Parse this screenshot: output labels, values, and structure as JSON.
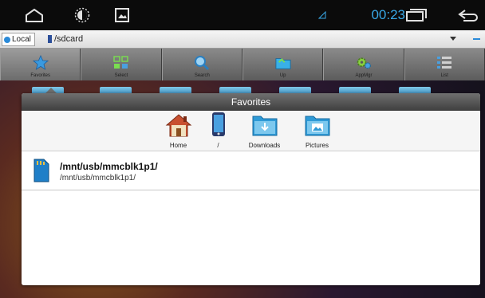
{
  "statusbar": {
    "clock": "00:23",
    "icons": [
      "home-outline-icon",
      "brightness-icon",
      "gallery-icon",
      "signal-icon",
      "recent-apps-icon",
      "back-icon"
    ],
    "clock_color": "#39a9e8"
  },
  "pathbar": {
    "local_label": "Local",
    "path": "/sdcard"
  },
  "toolbar": {
    "buttons": [
      {
        "label": "Favorites",
        "icon": "star-icon"
      },
      {
        "label": "Select",
        "icon": "select-grid-icon"
      },
      {
        "label": "Search",
        "icon": "magnifier-icon"
      },
      {
        "label": "Up",
        "icon": "folder-up-icon"
      },
      {
        "label": "AppMgr",
        "icon": "gears-icon"
      },
      {
        "label": "List",
        "icon": "list-icon"
      }
    ]
  },
  "dialog": {
    "title": "Favorites",
    "bookmarks": [
      {
        "label": "Home",
        "icon": "house-icon"
      },
      {
        "label": "/",
        "icon": "phone-icon"
      },
      {
        "label": "Downloads",
        "icon": "downloads-folder-icon"
      },
      {
        "label": "Pictures",
        "icon": "pictures-folder-icon"
      }
    ],
    "items": [
      {
        "title": "/mnt/usb/mmcblk1p1/",
        "subtitle": "/mnt/usb/mmcblk1p1/",
        "icon": "sd-card-icon"
      }
    ]
  },
  "colors": {
    "accent": "#2a8ad8",
    "toolbar": "#6c6c6c",
    "dialog_header": "#4a4a4a"
  }
}
